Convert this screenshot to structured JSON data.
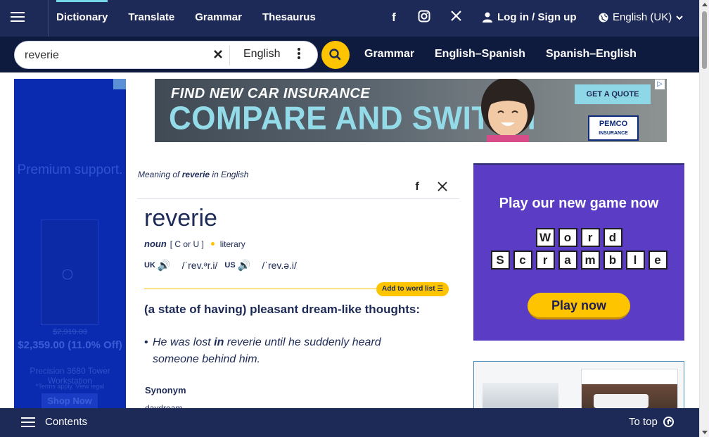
{
  "topnav": {
    "links": [
      "Dictionary",
      "Translate",
      "Grammar",
      "Thesaurus"
    ],
    "social_icons": [
      "facebook-icon",
      "instagram-icon",
      "x-icon"
    ],
    "login_label": "Log in / Sign up",
    "language_label": "English (UK)"
  },
  "search": {
    "value": "reverie",
    "dictionary": "English",
    "sublinks": [
      "Grammar",
      "English–Spanish",
      "Spanish–English"
    ]
  },
  "left_ad": {
    "headline": "Premium support.",
    "old_price": "$2,919.00",
    "price": "$2,359.00 (11.0% Off)",
    "model": "Precision 3680 Tower Workstation",
    "terms": "*Terms apply. View legal",
    "cta": "Shop Now"
  },
  "banner_ad": {
    "line1": "FIND NEW CAR INSURANCE",
    "line2": "COMPARE AND SWITCH",
    "cta": "GET A QUOTE",
    "brand": "PEMCO",
    "brand_sub": "INSURANCE"
  },
  "entry": {
    "meaning_prefix": "Meaning of ",
    "meaning_word": "reverie",
    "meaning_suffix": " in English",
    "headword": "reverie",
    "pos": "noun",
    "grammar": "[ C or U ]",
    "register": "literary",
    "uk_label": "UK",
    "uk_ipa": "/ˈrev.ᵊr.i/",
    "us_label": "US",
    "us_ipa": "/ˈrev.ə.i/",
    "add_to_list": "Add to word list",
    "definition": "(a state of having) pleasant dream-like thoughts:",
    "example_pre": "He was lost ",
    "example_bold": "in",
    "example_post": " reverie until he suddenly heard someone behind him.",
    "synonym_heading": "Synonym",
    "synonym": "daydream"
  },
  "right_ad": {
    "title": "Play our new game now",
    "row1": [
      "W",
      "o",
      "r",
      "d"
    ],
    "row2": [
      "S",
      "c",
      "r",
      "a",
      "m",
      "b",
      "l",
      "e"
    ],
    "cta": "Play now"
  },
  "bottombar": {
    "contents_label": "Contents",
    "totop_label": "To top"
  },
  "colors": {
    "navy": "#1d2a57",
    "accent_yellow": "#fec400",
    "accent_cyan": "#76d7ea",
    "ad_purple": "#5b3cc4"
  }
}
